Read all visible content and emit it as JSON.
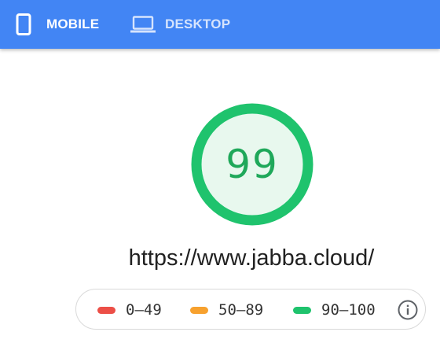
{
  "tabs": {
    "mobile": {
      "label": "MOBILE",
      "icon": "phone-icon",
      "active": true
    },
    "desktop": {
      "label": "DESKTOP",
      "icon": "laptop-icon",
      "active": false
    }
  },
  "report": {
    "score": "99",
    "url": "https://www.jabba.cloud/"
  },
  "legend": {
    "items": [
      {
        "range": "0–49",
        "color": "#ec4f47"
      },
      {
        "range": "50–89",
        "color": "#f7a12e"
      },
      {
        "range": "90–100",
        "color": "#1fc36d"
      }
    ],
    "info_icon": "info-icon"
  },
  "colors": {
    "tabbar_bg": "#4285f4",
    "gauge_ring": "#1fc36d",
    "gauge_fill": "#e8f8ee",
    "score_text": "#1fa85a"
  }
}
